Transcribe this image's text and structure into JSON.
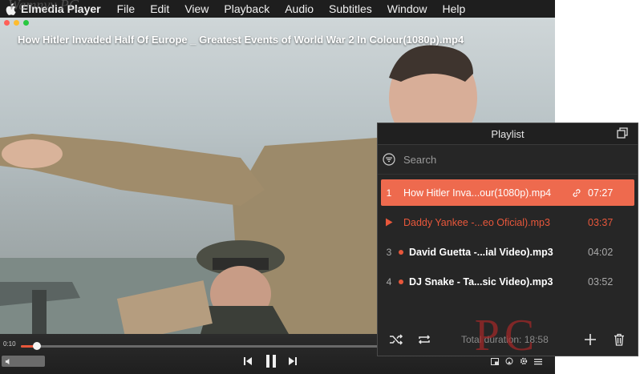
{
  "menubar": {
    "app_name": "Elmedia Player",
    "items": [
      "File",
      "Edit",
      "View",
      "Playback",
      "Audio",
      "Subtitles",
      "Window",
      "Help"
    ]
  },
  "watermark": "Wamnyy PC",
  "video": {
    "title": "How Hitler Invaded Half Of Europe _ Greatest Events of World War 2 In Colour(1080p).mp4",
    "current_time": "0:10",
    "progress_fraction": 0.03
  },
  "playlist": {
    "title": "Playlist",
    "search_placeholder": "Search",
    "items": [
      {
        "index": "1",
        "name": "How Hitler Inva...our(1080p).mp4",
        "duration": "07:27",
        "state": "selected"
      },
      {
        "index": "",
        "name": "Daddy Yankee -...eo Oficial).mp3",
        "duration": "03:37",
        "state": "playing"
      },
      {
        "index": "3",
        "name": "David Guetta -...ial Video).mp3",
        "duration": "04:02",
        "state": "normal"
      },
      {
        "index": "4",
        "name": "DJ Snake - Ta...sic Video).mp3",
        "duration": "03:52",
        "state": "normal"
      }
    ],
    "total_duration": "Total duration: 18:58"
  },
  "logo_text": "PC",
  "colors": {
    "accent": "#ee6a4e",
    "panel_bg": "#262626",
    "menubar_bg": "#1e1e1e"
  }
}
